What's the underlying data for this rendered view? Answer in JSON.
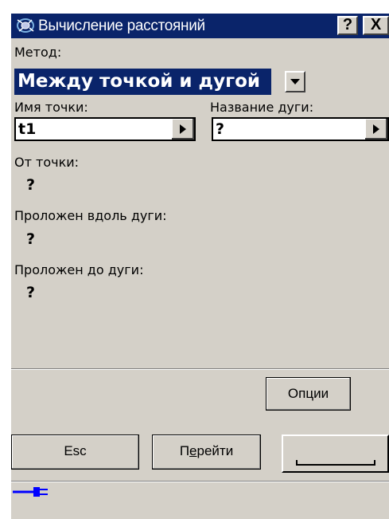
{
  "window": {
    "title": "Вычисление расстояний",
    "help_label": "?",
    "close_label": "X"
  },
  "method": {
    "label": "Метод:",
    "selected": "Между точкой и дугой"
  },
  "point_name": {
    "label": "Имя точки:",
    "value": "t1"
  },
  "arc_name": {
    "label": "Название дуги:",
    "value": "?"
  },
  "results": {
    "from_point": {
      "label": "От точки:",
      "value": "?"
    },
    "along_arc": {
      "label": "Проложен вдоль дуги:",
      "value": "?"
    },
    "to_arc": {
      "label": "Проложен до дуги:",
      "value": "?"
    }
  },
  "buttons": {
    "options": "Опции",
    "esc": "Esc",
    "goto_pre": "П",
    "goto_mnemonic": "е",
    "goto_post": "рейти"
  },
  "status": {
    "icon": "power-plug-icon",
    "color": "#0000ff"
  },
  "colors": {
    "titlebar": "#0a246a",
    "selection": "#0a246a",
    "face": "#d4d0c8"
  }
}
